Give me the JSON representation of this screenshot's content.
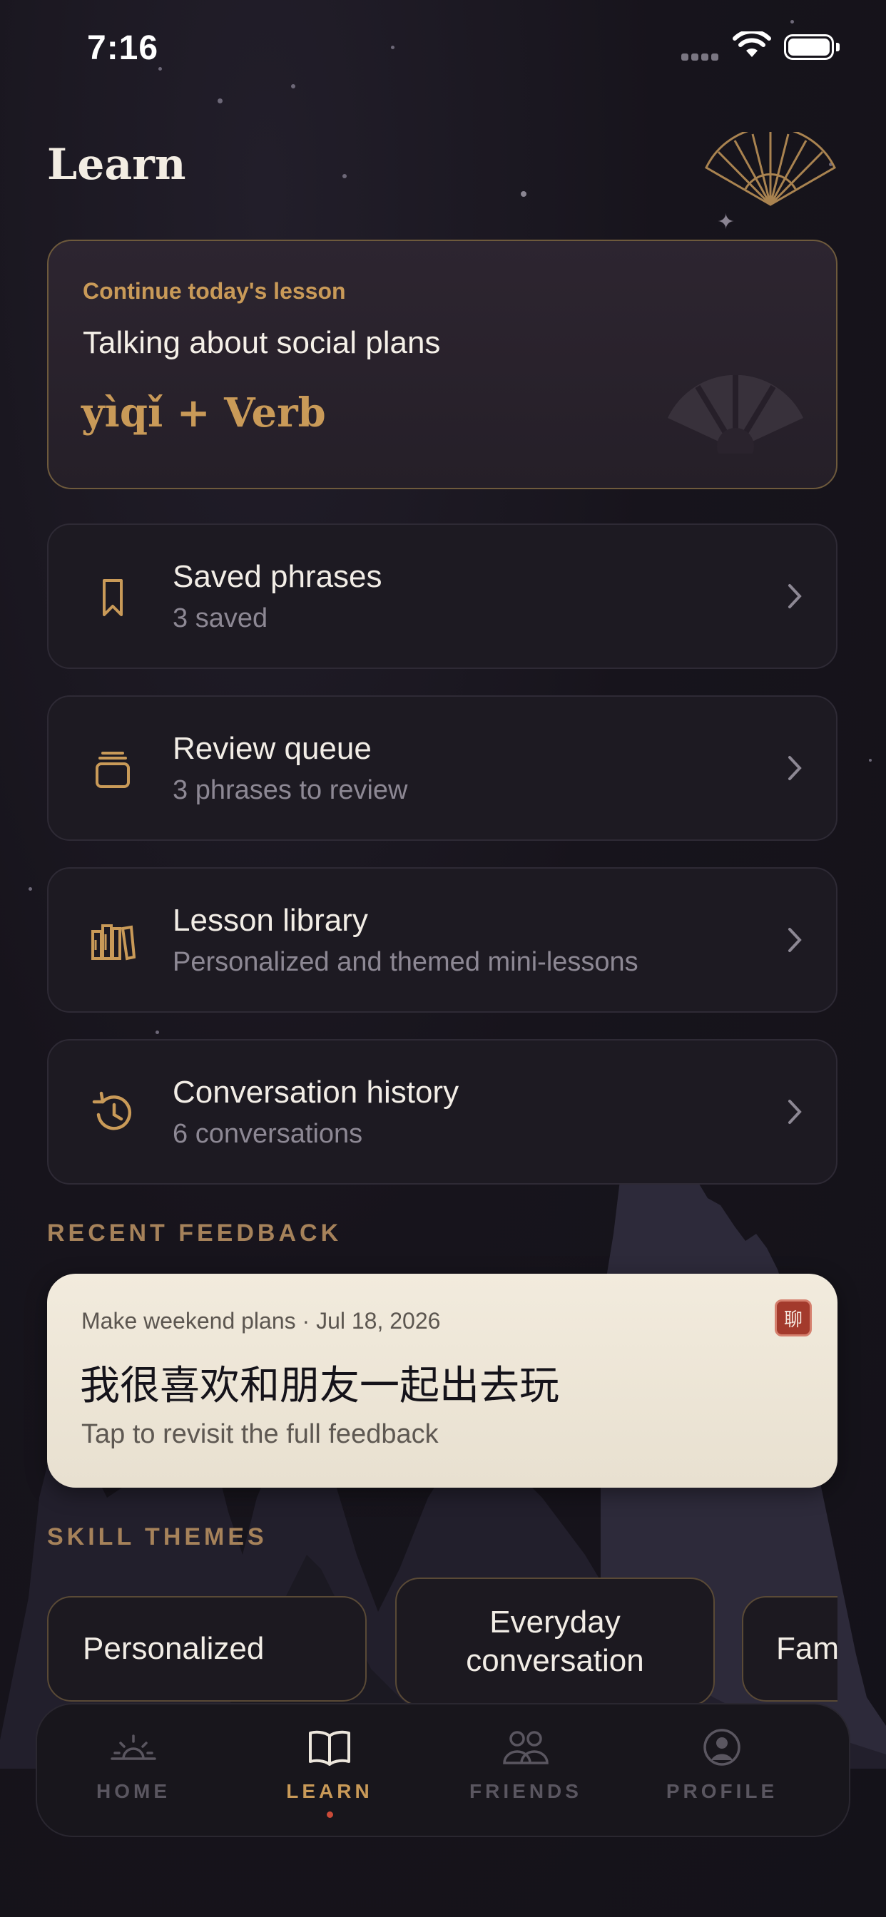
{
  "status_bar": {
    "time": "7:16"
  },
  "header": {
    "title": "Learn"
  },
  "lesson_card": {
    "eyebrow": "Continue today's lesson",
    "title": "Talking about social plans",
    "grammar": "yìqǐ + Verb"
  },
  "menu": [
    {
      "title": "Saved phrases",
      "subtitle": "3 saved",
      "icon": "bookmark-icon"
    },
    {
      "title": "Review queue",
      "subtitle": "3 phrases to review",
      "icon": "card-stack-icon"
    },
    {
      "title": "Lesson library",
      "subtitle": "Personalized and themed mini-lessons",
      "icon": "books-icon"
    },
    {
      "title": "Conversation history",
      "subtitle": "6 conversations",
      "icon": "history-icon"
    }
  ],
  "recent_feedback": {
    "label": "RECENT FEEDBACK",
    "meta": "Make weekend plans · Jul 18, 2026",
    "sentence": "我很喜欢和朋友一起出去玩",
    "hint": "Tap to revisit the full feedback",
    "seal": "聊"
  },
  "skill_themes": {
    "label": "SKILL THEMES",
    "chips": [
      "Personalized",
      "Everyday conversation",
      "Fam"
    ]
  },
  "tabs": [
    {
      "label": "HOME",
      "icon": "sunrise-icon",
      "active": false
    },
    {
      "label": "LEARN",
      "icon": "open-book-icon",
      "active": true
    },
    {
      "label": "FRIENDS",
      "icon": "people-icon",
      "active": false
    },
    {
      "label": "PROFILE",
      "icon": "profile-icon",
      "active": false
    }
  ],
  "colors": {
    "accent_gold": "#c99a58",
    "background": "#17141c",
    "feedback_card": "#f2ebdd",
    "active_dot": "#c94a38"
  }
}
